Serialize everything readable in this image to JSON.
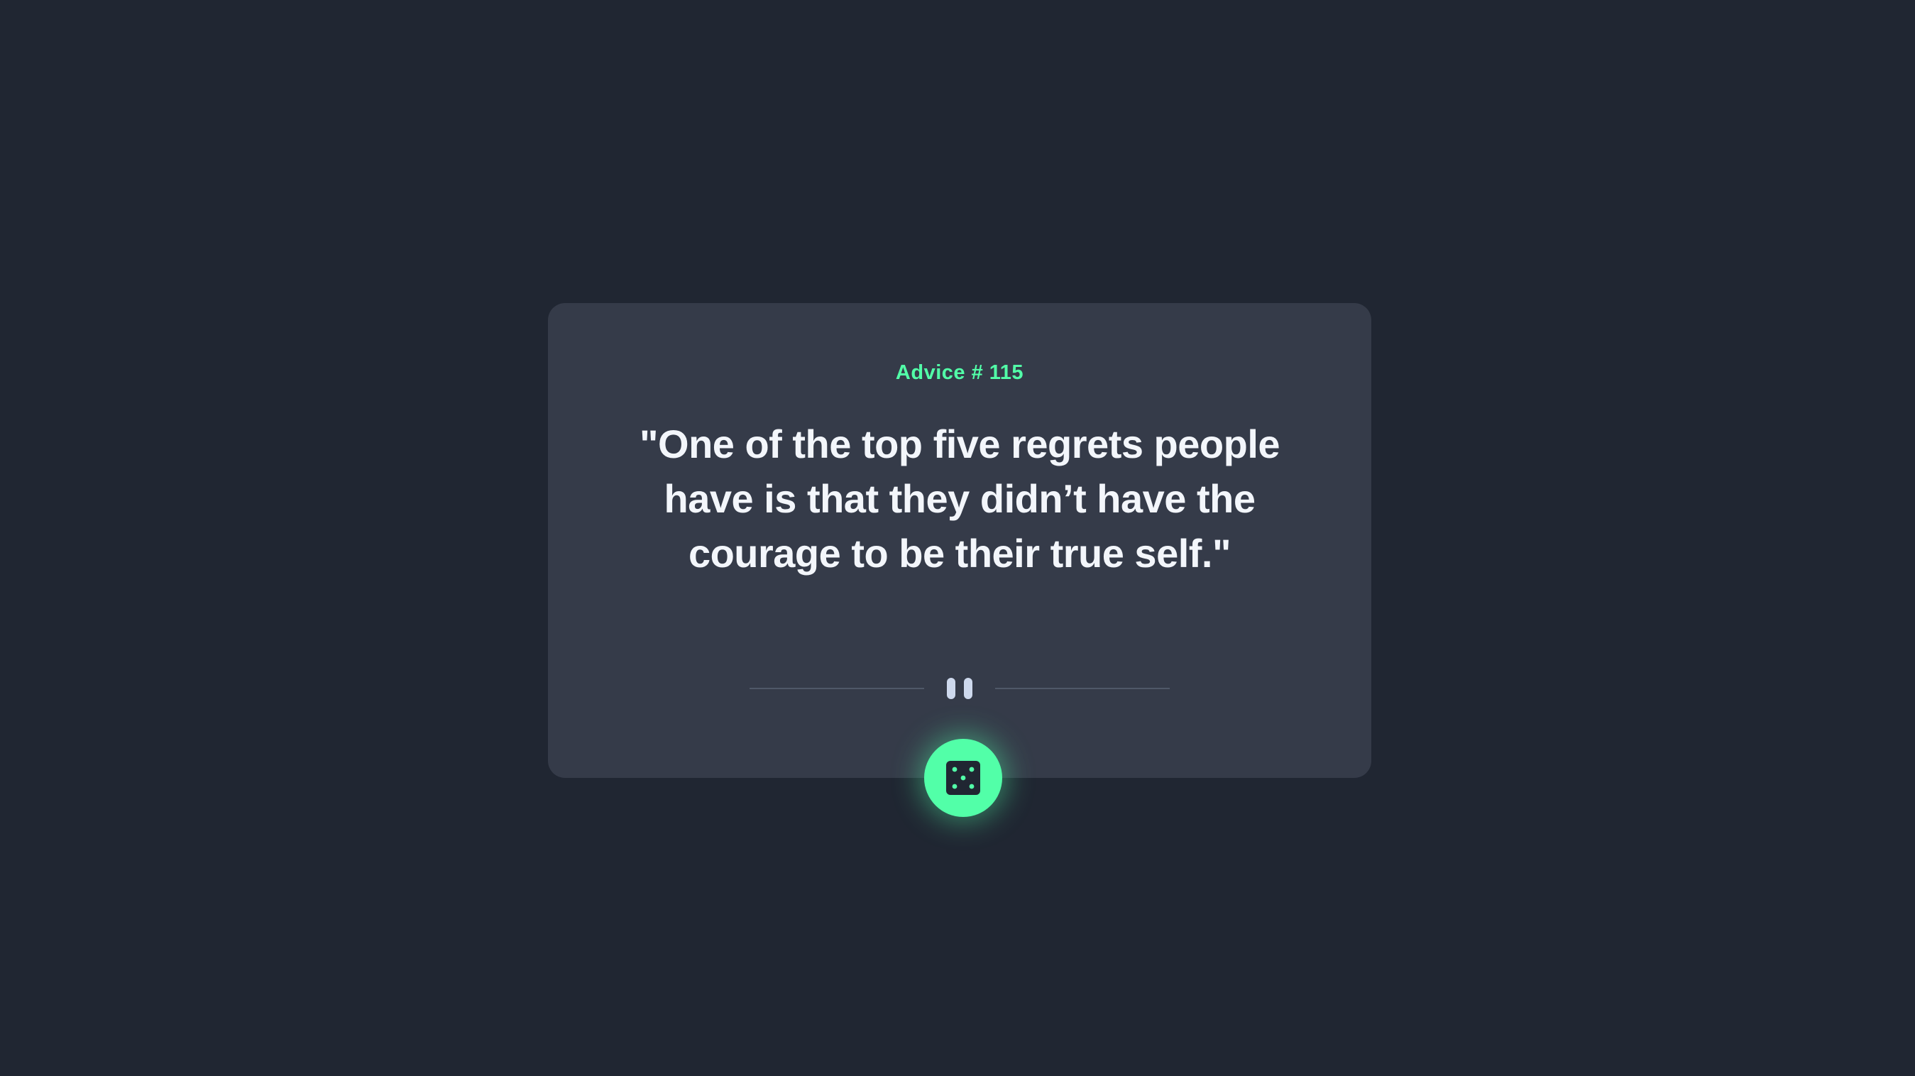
{
  "card": {
    "advice_label": "Advice # 115",
    "quote": "\"One of the top five regrets people have is that they didn’t have the courage to be their true self.\""
  },
  "icons": {
    "divider": "pause-icon",
    "button": "dice-icon"
  },
  "colors": {
    "background": "#202632",
    "card": "#353b49",
    "accent": "#52ffa8",
    "text": "#f3f6fb"
  }
}
